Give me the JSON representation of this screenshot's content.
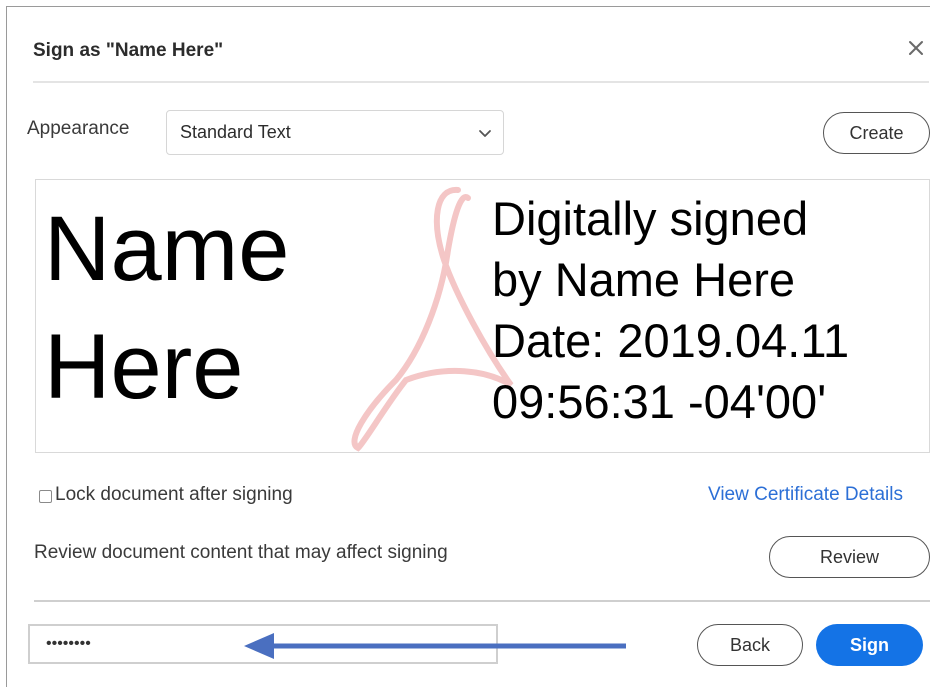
{
  "dialog": {
    "title": "Sign as \"Name Here\""
  },
  "appearance": {
    "label": "Appearance",
    "selected": "Standard Text",
    "create_label": "Create"
  },
  "preview": {
    "name_line1": "Name",
    "name_line2": "Here",
    "details": [
      "Digitally signed",
      "by Name Here",
      "Date: 2019.04.11",
      "09:56:31 -04'00'"
    ]
  },
  "options": {
    "lock_label": "Lock document after signing",
    "lock_checked": false,
    "view_cert_label": "View Certificate Details"
  },
  "review": {
    "text": "Review document content that may affect signing",
    "button_label": "Review"
  },
  "footer": {
    "password_value": "••••••••",
    "back_label": "Back",
    "sign_label": "Sign"
  },
  "colors": {
    "accent": "#1473e6",
    "link": "#2c6fd6",
    "annotation_arrow": "#4a6fc0",
    "logo_watermark": "#f2c4c4"
  },
  "icons": {
    "close": "close-icon",
    "dropdown": "chevron-down-icon",
    "watermark": "acrobat-logo-icon",
    "annotation": "arrow-left-icon"
  }
}
